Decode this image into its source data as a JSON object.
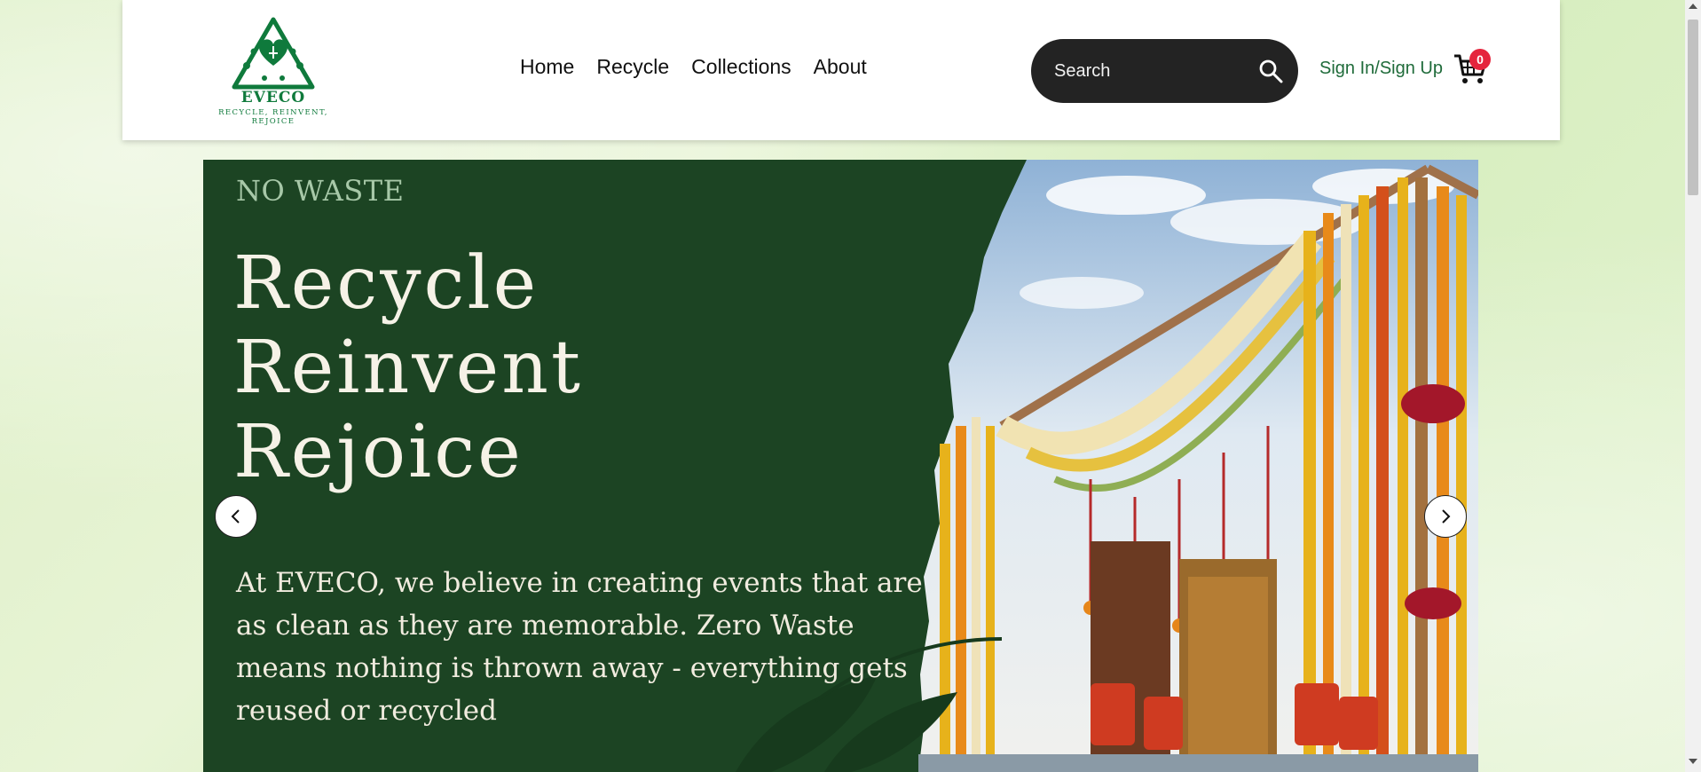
{
  "header": {
    "logo_name": "EVECO",
    "logo_tagline": "RECYCLE, REINVENT, REJOICE",
    "nav": [
      "Home",
      "Recycle",
      "Collections",
      "About"
    ],
    "search_placeholder": "Search",
    "signin_label": "Sign In/Sign Up",
    "cart_count": "0"
  },
  "hero": {
    "eyebrow": "NO WASTE",
    "headline": [
      "Recycle",
      "Reinvent",
      "Rejoice"
    ],
    "description": "At EVECO, we believe in  creating events that are as clean as they are memorable. Zero Waste means nothing is thrown away - everything gets reused or recycled"
  },
  "colors": {
    "brand_green": "#0f7a3c",
    "hero_green": "#1c4423",
    "search_bg": "#232323",
    "badge_red": "#e5253d",
    "signin_green": "#1f6b3a"
  },
  "icons": [
    "recycle-heart-logo-icon",
    "search-icon",
    "cart-icon",
    "chevron-left-icon",
    "chevron-right-icon"
  ]
}
